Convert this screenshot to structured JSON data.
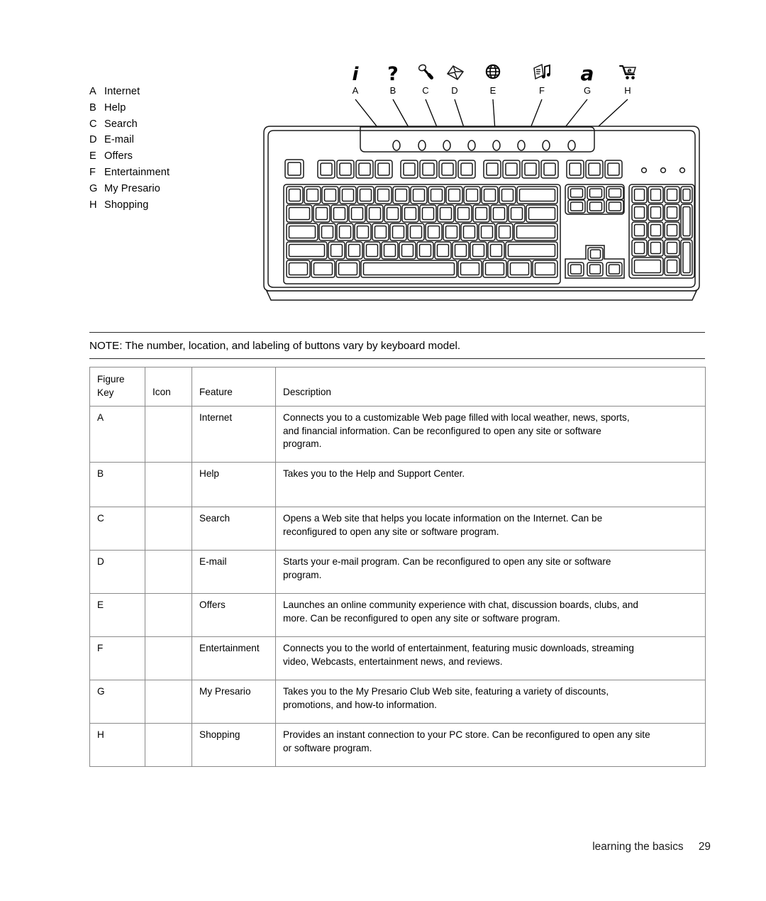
{
  "legend": {
    "items": [
      {
        "key": "A",
        "label": "Internet",
        "icon": "info-i-icon"
      },
      {
        "key": "B",
        "label": "Help",
        "icon": "question-mark-icon"
      },
      {
        "key": "C",
        "label": "Search",
        "icon": "magnifying-glass-icon"
      },
      {
        "key": "D",
        "label": "E-mail",
        "icon": "envelope-icon"
      },
      {
        "key": "E",
        "label": "Offers",
        "icon": "globe-icon"
      },
      {
        "key": "F",
        "label": "Entertainment",
        "icon": "music-note-page-icon"
      },
      {
        "key": "G",
        "label": "My Presario",
        "icon": "stylized-a-icon"
      },
      {
        "key": "H",
        "label": "Shopping",
        "icon": "shopping-cart-icon"
      }
    ]
  },
  "figure": {
    "caption_labels": [
      "A",
      "B",
      "C",
      "D",
      "E",
      "F",
      "G",
      "H"
    ],
    "alt": "keyboard-diagram"
  },
  "note": {
    "text": "NOTE: The number, location, and labeling of buttons vary by keyboard model."
  },
  "table": {
    "headers": {
      "figure_key_line1": "Figure",
      "figure_key_line2": "Key",
      "icon": "Icon",
      "feature": "Feature",
      "description": "Description"
    },
    "rows": [
      {
        "key": "A",
        "icon": "",
        "feature": "Internet",
        "description_lines": [
          "Connects you to a customizable Web page filled with local weather, news, sports,",
          "and financial information. Can be reconfigured to open any site or software",
          "program."
        ]
      },
      {
        "key": "B",
        "icon": "",
        "feature": "Help",
        "description_lines": [
          "Takes you to the Help and Support Center."
        ]
      },
      {
        "key": "C",
        "icon": "",
        "feature": "Search",
        "description_lines": [
          "Opens a Web site that helps you locate information on the Internet. Can be",
          "reconfigured to open any site or software program."
        ]
      },
      {
        "key": "D",
        "icon": "",
        "feature": "E-mail",
        "description_lines": [
          "Starts your e-mail program. Can be reconfigured to open any site or software",
          "program."
        ]
      },
      {
        "key": "E",
        "icon": "",
        "feature": "Offers",
        "description_lines": [
          "Launches an online community experience with chat, discussion boards, clubs, and",
          "more. Can be reconfigured to open any site or software program."
        ]
      },
      {
        "key": "F",
        "icon": "",
        "feature": "Entertainment",
        "description_lines": [
          "Connects you to the world of entertainment, featuring music downloads, streaming",
          "video, Webcasts, entertainment news, and reviews."
        ]
      },
      {
        "key": "G",
        "icon": "",
        "feature": "My Presario",
        "description_lines": [
          "Takes you to the My Presario Club Web site, featuring a variety of discounts,",
          "promotions, and how-to information."
        ]
      },
      {
        "key": "H",
        "icon": "",
        "feature": "Shopping",
        "description_lines": [
          "Provides an instant connection to your PC store. Can be reconfigured to open any site",
          "or software program."
        ]
      }
    ]
  },
  "footer": {
    "section": "learning the basics",
    "page_number": "29"
  },
  "colors": {
    "text": "#000000",
    "rule": "#2b2b2b",
    "table_border": "#8a8a8a",
    "keyboard_line": "#1a1a1a"
  }
}
